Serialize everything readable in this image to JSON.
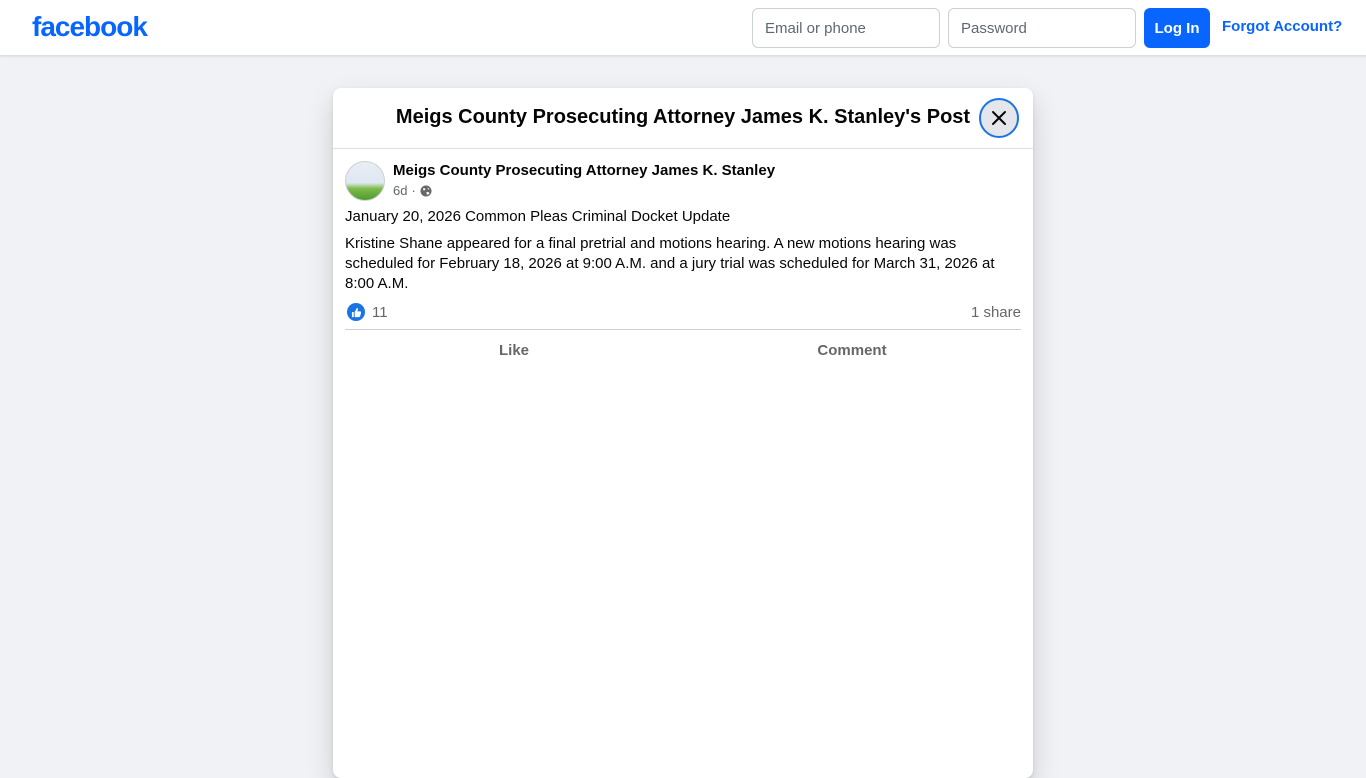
{
  "header": {
    "logo_text": "facebook",
    "email_placeholder": "Email or phone",
    "password_placeholder": "Password",
    "login_label": "Log In",
    "forgot_label": "Forgot Account?"
  },
  "modal": {
    "title": "Meigs County Prosecuting Attorney James K. Stanley's Post",
    "close_icon": "close-icon"
  },
  "post": {
    "author": "Meigs County Prosecuting Attorney James K. Stanley",
    "age": "6d",
    "separator": "·",
    "privacy_icon": "globe-icon",
    "heading": "January 20, 2026 Common Pleas Criminal Docket Update",
    "body": "Kristine Shane appeared for a final pretrial and motions hearing.  A new motions hearing was scheduled for February 18, 2026 at 9:00 A.M. and a jury trial was scheduled for March 31, 2026 at 8:00 A.M.",
    "like_count": "11",
    "share_count": "1 share",
    "actions": {
      "like": "Like",
      "comment": "Comment"
    }
  },
  "colors": {
    "brand": "#0866ff",
    "background": "#f0f2f5",
    "secondary_text": "#65676b"
  }
}
